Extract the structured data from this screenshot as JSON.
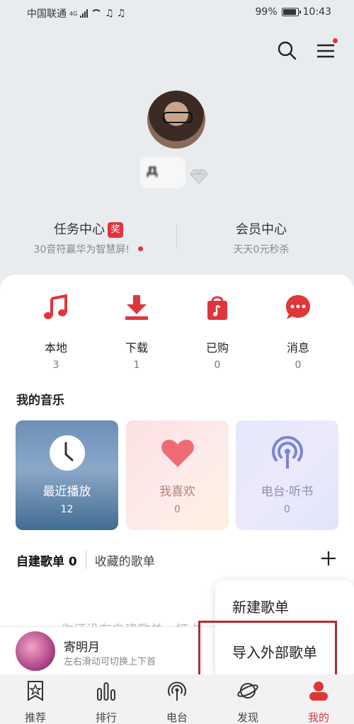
{
  "status_bar": {
    "carrier": "中国联通",
    "network": "4G",
    "battery": "99%",
    "time": "10:43"
  },
  "profile": {
    "nickname_masked": "д",
    "task_center": {
      "title": "任务中心",
      "badge": "奖",
      "subtitle": "30音符赢华为智慧屏!"
    },
    "member_center": {
      "title": "会员中心",
      "subtitle": "天天0元秒杀"
    }
  },
  "quick_actions": [
    {
      "label": "本地",
      "count": "3",
      "icon": "music-note-icon"
    },
    {
      "label": "下载",
      "count": "1",
      "icon": "download-icon"
    },
    {
      "label": "已购",
      "count": "0",
      "icon": "purchased-bag-icon"
    },
    {
      "label": "消息",
      "count": "0",
      "icon": "message-bubble-icon"
    }
  ],
  "my_music": {
    "title": "我的音乐",
    "tiles": [
      {
        "label": "最近播放",
        "count": "12",
        "icon": "clock-icon"
      },
      {
        "label": "我喜欢",
        "count": "0",
        "icon": "heart-icon"
      },
      {
        "label": "电台·听书",
        "count": "0",
        "icon": "broadcast-icon"
      }
    ]
  },
  "playlist_tabs": {
    "created": "自建歌单",
    "created_count": "0",
    "collected": "收藏的歌单",
    "empty_hint": "你还没有自建歌单，打卡"
  },
  "popup_menu": {
    "items": [
      "新建歌单",
      "导入外部歌单"
    ]
  },
  "player": {
    "title": "寄明月",
    "subtitle": "左右滑动可切换上下首"
  },
  "bottom_nav": [
    {
      "label": "推荐",
      "icon": "star-bookmark-icon"
    },
    {
      "label": "排行",
      "icon": "bar-chart-icon"
    },
    {
      "label": "电台",
      "icon": "radio-icon"
    },
    {
      "label": "发现",
      "icon": "planet-icon"
    },
    {
      "label": "我的",
      "icon": "my-music-icon",
      "active": true
    }
  ],
  "colors": {
    "accent": "#e0353b",
    "background": "#e9ecef"
  }
}
